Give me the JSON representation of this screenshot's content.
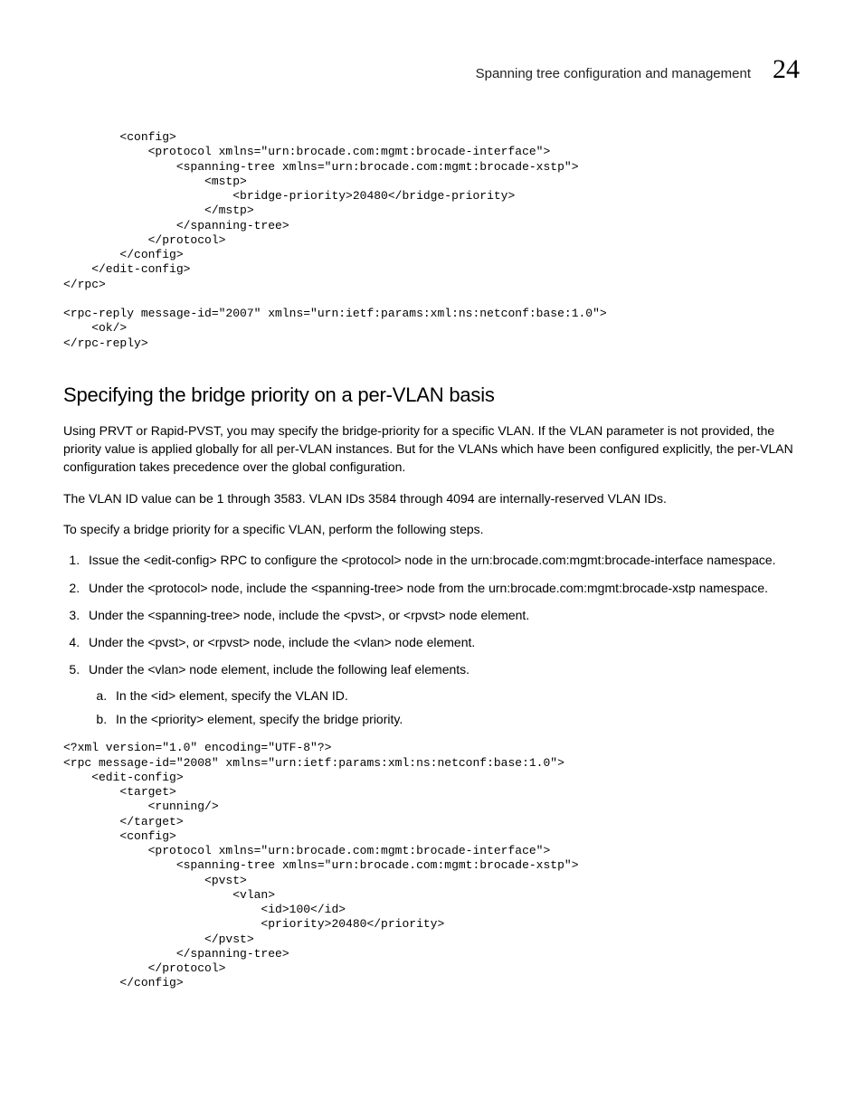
{
  "header": {
    "title": "Spanning tree configuration and management",
    "chapter": "24"
  },
  "code1": "        <config>\n            <protocol xmlns=\"urn:brocade.com:mgmt:brocade-interface\">\n                <spanning-tree xmlns=\"urn:brocade.com:mgmt:brocade-xstp\">\n                    <mstp>\n                        <bridge-priority>20480</bridge-priority>\n                    </mstp>\n                </spanning-tree>\n            </protocol>\n        </config>\n    </edit-config>\n</rpc>\n\n<rpc-reply message-id=\"2007\" xmlns=\"urn:ietf:params:xml:ns:netconf:base:1.0\">\n    <ok/>\n</rpc-reply>",
  "section": {
    "heading": "Specifying the bridge priority on a per-VLAN basis",
    "p1": "Using PRVT or Rapid-PVST, you may specify the bridge-priority for a specific VLAN. If the VLAN parameter is not provided, the priority value is applied globally for all per-VLAN instances. But for the VLANs which have been configured explicitly, the per-VLAN configuration takes precedence over the global configuration.",
    "p2": "The VLAN ID value can be 1 through 3583. VLAN IDs 3584 through 4094 are internally-reserved VLAN IDs.",
    "p3": "To specify a bridge priority for a specific VLAN, perform the following steps.",
    "steps": {
      "s1": "Issue the <edit-config> RPC to configure the <protocol> node in the urn:brocade.com:mgmt:brocade-interface namespace.",
      "s2": "Under the <protocol> node, include the <spanning-tree> node from the urn:brocade.com:mgmt:brocade-xstp namespace.",
      "s3": "Under the <spanning-tree> node, include the <pvst>, or <rpvst> node element.",
      "s4": "Under the <pvst>, or <rpvst> node, include the <vlan> node element.",
      "s5": "Under the <vlan> node element, include the following leaf elements.",
      "sub_a": "In the <id> element, specify the VLAN ID.",
      "sub_b": "In the <priority> element, specify the bridge priority."
    }
  },
  "code2": "<?xml version=\"1.0\" encoding=\"UTF-8\"?>\n<rpc message-id=\"2008\" xmlns=\"urn:ietf:params:xml:ns:netconf:base:1.0\">\n    <edit-config>\n        <target>\n            <running/>\n        </target>\n        <config>\n            <protocol xmlns=\"urn:brocade.com:mgmt:brocade-interface\">\n                <spanning-tree xmlns=\"urn:brocade.com:mgmt:brocade-xstp\">\n                    <pvst>\n                        <vlan>\n                            <id>100</id>\n                            <priority>20480</priority>\n                    </pvst>\n                </spanning-tree>\n            </protocol>\n        </config>"
}
